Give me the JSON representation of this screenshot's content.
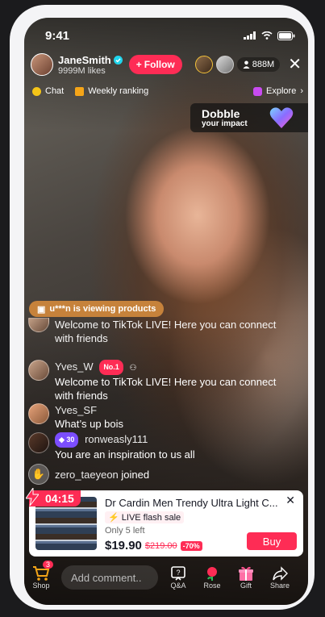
{
  "status_bar": {
    "time": "9:41"
  },
  "host": {
    "name": "JaneSmith",
    "likes": "9999M likes",
    "follow_label": "Follow"
  },
  "viewers": {
    "count": "888M"
  },
  "nav": {
    "chat": "Chat",
    "ranking": "Weekly ranking",
    "explore": "Explore"
  },
  "promo": {
    "title": "Dobble",
    "subtitle": "your impact"
  },
  "viewing_banner": "u***n is viewing products",
  "comments": [
    {
      "text": "Welcome to TikTok LIVE! Here you can connect with friends"
    },
    {
      "user": "Yves_W",
      "badge": "No.1",
      "text": "Welcome to TikTok LIVE! Here you can connect with friends"
    },
    {
      "user": "Yves_SF",
      "text": "What’s up bois"
    },
    {
      "level": "30",
      "user": "ronweasly111",
      "text": "You are an inspiration to us all"
    },
    {
      "user": "zero_taeyeon",
      "action": "joined"
    }
  ],
  "product": {
    "timer": "04:15",
    "name": "Dr Cardin Men Trendy Ultra Light C...",
    "flash_label": "LIVE flash sale",
    "stock": "Only 5 left",
    "price": "$19.90",
    "old_price": "$219.00",
    "discount": "-70%",
    "buy_label": "Buy"
  },
  "bottom_bar": {
    "shop_label": "Shop",
    "shop_count": "3",
    "comment_placeholder": "Add comment..",
    "qa_label": "Q&A",
    "rose_label": "Rose",
    "gift_label": "Gift",
    "share_label": "Share"
  },
  "colors": {
    "accent": "#fe2c55",
    "banner": "#c6823b",
    "level_badge": "#7b4dff"
  }
}
